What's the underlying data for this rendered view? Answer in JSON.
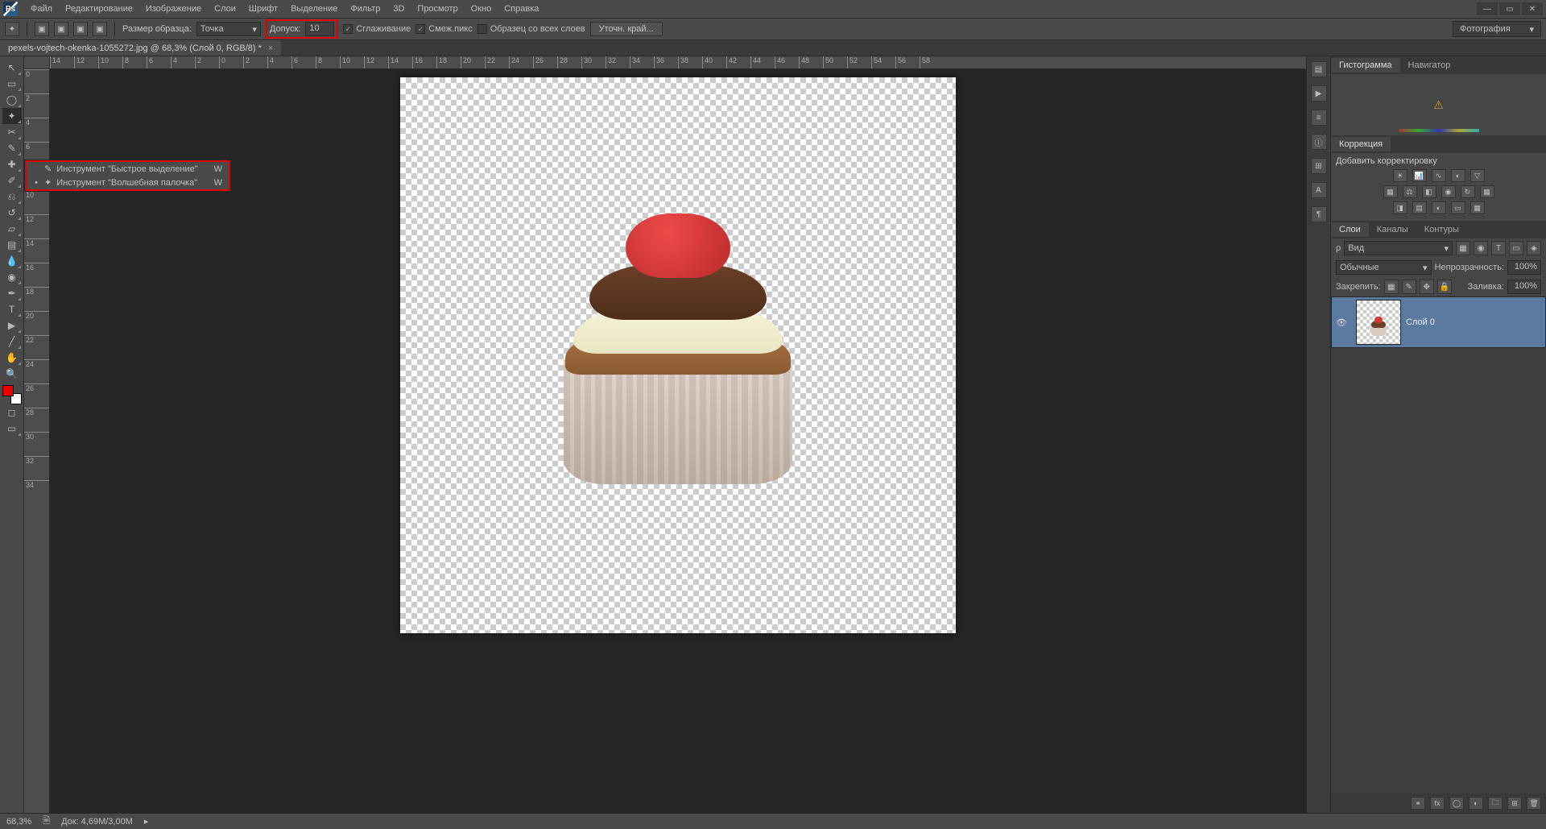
{
  "menu": [
    "Файл",
    "Редактирование",
    "Изображение",
    "Слои",
    "Шрифт",
    "Выделение",
    "Фильтр",
    "3D",
    "Просмотр",
    "Окно",
    "Справка"
  ],
  "options": {
    "sample_size_label": "Размер образца:",
    "sample_size_value": "Точка",
    "tolerance_label": "Допуск:",
    "tolerance_value": "10",
    "antialias": "Сглаживание",
    "contiguous": "Смеж.пикс",
    "all_layers": "Образец со всех слоев",
    "refine_edge": "Уточн. край..."
  },
  "workspace": "Фотография",
  "document": {
    "title": "pexels-vojtech-okenka-1055272.jpg @ 68,3% (Слой 0, RGB/8) *"
  },
  "flyout": {
    "quick_select": "Инструмент \"Быстрое выделение\"",
    "magic_wand": "Инструмент \"Волшебная палочка\"",
    "key": "W"
  },
  "ruler_h": [
    "14",
    "12",
    "10",
    "8",
    "6",
    "4",
    "2",
    "0",
    "2",
    "4",
    "6",
    "8",
    "10",
    "12",
    "14",
    "16",
    "18",
    "20",
    "22",
    "24",
    "26",
    "28",
    "30",
    "32",
    "34",
    "36",
    "38",
    "40",
    "42",
    "44",
    "46",
    "48",
    "50",
    "52",
    "54",
    "56",
    "58"
  ],
  "ruler_v": [
    "0",
    "2",
    "4",
    "6",
    "8",
    "10",
    "12",
    "14",
    "16",
    "18",
    "20",
    "22",
    "24",
    "26",
    "28",
    "30",
    "32",
    "34"
  ],
  "panels": {
    "hist_tabs": [
      "Гистограмма",
      "Навигатор"
    ],
    "correction_tab": "Коррекция",
    "add_adjustment": "Добавить корректировку",
    "layer_tabs": [
      "Слои",
      "Каналы",
      "Контуры"
    ],
    "blend_mode_label": "Вид",
    "blend_mode": "Обычные",
    "opacity_label": "Непрозрачность:",
    "opacity_value": "100%",
    "lock_label": "Закрепить:",
    "fill_label": "Заливка:",
    "fill_value": "100%",
    "layer0_name": "Слой 0"
  },
  "status": {
    "zoom": "68,3%",
    "doc": "Док: 4,69M/3,00M"
  }
}
